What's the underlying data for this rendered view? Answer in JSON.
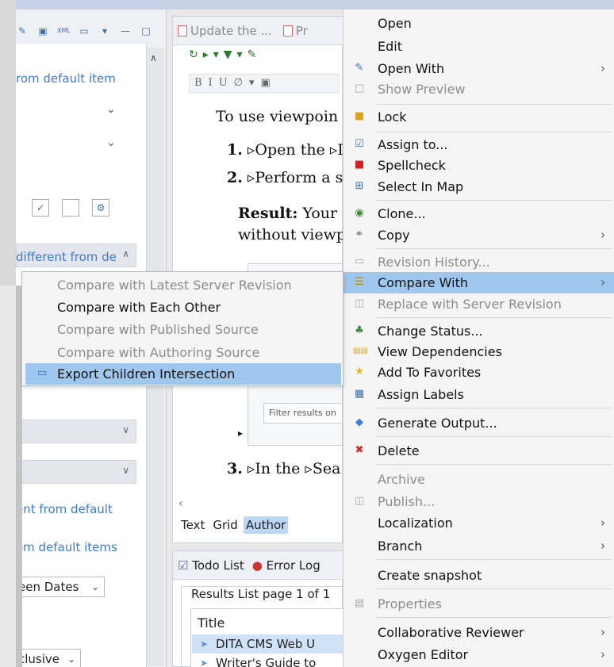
{
  "left_panel": {
    "link_1": "rom default item",
    "link_2": "different from de",
    "link_3": "ent from default",
    "link_4": "om default items",
    "select_1": "een Dates",
    "select_2": "clusive"
  },
  "editor": {
    "tab_1": "Update the ...",
    "tab_2": "Pr",
    "line_1": "To use viewpoin",
    "step_1_num": "1.",
    "step_1_text": "▹Open the ▹I",
    "step_2_num": "2.",
    "step_2_text": "▹Perform a s",
    "result_label": "Result:",
    "result_text": " Your",
    "result_line2": "without viewp",
    "filter_placeholder": "Filter results on",
    "step_3_num": "3.",
    "step_3_text": "▹In the ▹Sea",
    "bottom_tabs": [
      "Text",
      "Grid",
      "Author"
    ]
  },
  "todo": {
    "tab_1": "Todo List",
    "tab_2": "Error Log",
    "group_header": "Results List page 1 of 1",
    "col_title": "Title",
    "rows": [
      "DITA CMS Web U",
      "Writer's Guide to"
    ]
  },
  "context_menu": {
    "items": [
      {
        "label": "Open",
        "icon": "",
        "disabled": false
      },
      {
        "label": "Edit",
        "icon": "",
        "disabled": false
      },
      {
        "label": "Open With",
        "icon": "open-with-icon",
        "disabled": false,
        "submenu": true
      },
      {
        "label": "Show Preview",
        "icon": "preview-icon",
        "disabled": true
      },
      {
        "label": "Lock",
        "icon": "lock-icon",
        "disabled": false
      },
      {
        "label": "Assign to...",
        "icon": "assign-icon",
        "disabled": false
      },
      {
        "label": "Spellcheck",
        "icon": "spellcheck-icon",
        "disabled": false
      },
      {
        "label": "Select In Map",
        "icon": "map-icon",
        "disabled": false
      },
      {
        "label": "Clone...",
        "icon": "clone-icon",
        "disabled": false
      },
      {
        "label": "Copy",
        "icon": "copy-icon",
        "disabled": false,
        "submenu": true
      },
      {
        "label": "Revision History...",
        "icon": "history-icon",
        "disabled": true
      },
      {
        "label": "Compare With",
        "icon": "compare-icon",
        "disabled": false,
        "submenu": true,
        "highlighted": true
      },
      {
        "label": "Replace with Server Revision",
        "icon": "replace-icon",
        "disabled": true
      },
      {
        "label": "Change Status...",
        "icon": "status-icon",
        "disabled": false
      },
      {
        "label": "View Dependencies",
        "icon": "dependencies-icon",
        "disabled": false
      },
      {
        "label": "Add To Favorites",
        "icon": "star-icon",
        "disabled": false
      },
      {
        "label": "Assign Labels",
        "icon": "labels-icon",
        "disabled": false
      },
      {
        "label": "Generate Output...",
        "icon": "output-icon",
        "disabled": false
      },
      {
        "label": "Delete",
        "icon": "delete-icon",
        "disabled": false
      },
      {
        "label": "Archive",
        "icon": "",
        "disabled": true
      },
      {
        "label": "Publish...",
        "icon": "publish-icon",
        "disabled": true
      },
      {
        "label": "Localization",
        "icon": "",
        "disabled": false,
        "submenu": true
      },
      {
        "label": "Branch",
        "icon": "",
        "disabled": false,
        "submenu": true
      },
      {
        "label": "Create snapshot",
        "icon": "",
        "disabled": false
      },
      {
        "label": "Properties",
        "icon": "properties-icon",
        "disabled": true
      },
      {
        "label": "Collaborative Reviewer",
        "icon": "",
        "disabled": false,
        "submenu": true
      },
      {
        "label": "Oxygen Editor",
        "icon": "",
        "disabled": false,
        "submenu": true
      }
    ],
    "submenu_arrow": "›"
  },
  "compare_submenu": {
    "items": [
      {
        "label": "Compare with Latest Server Revision",
        "disabled": true
      },
      {
        "label": "Compare with Each Other",
        "disabled": false
      },
      {
        "label": "Compare with Published Source",
        "disabled": true
      },
      {
        "label": "Compare with Authoring Source",
        "disabled": true
      },
      {
        "label": "Export Children Intersection",
        "disabled": false,
        "highlighted": true
      }
    ]
  },
  "colors": {
    "highlight": "#9fc6ed",
    "link": "#3b7bd6",
    "disabled_text": "#8c8c8c",
    "menu_bg": "#f5f5f5"
  }
}
